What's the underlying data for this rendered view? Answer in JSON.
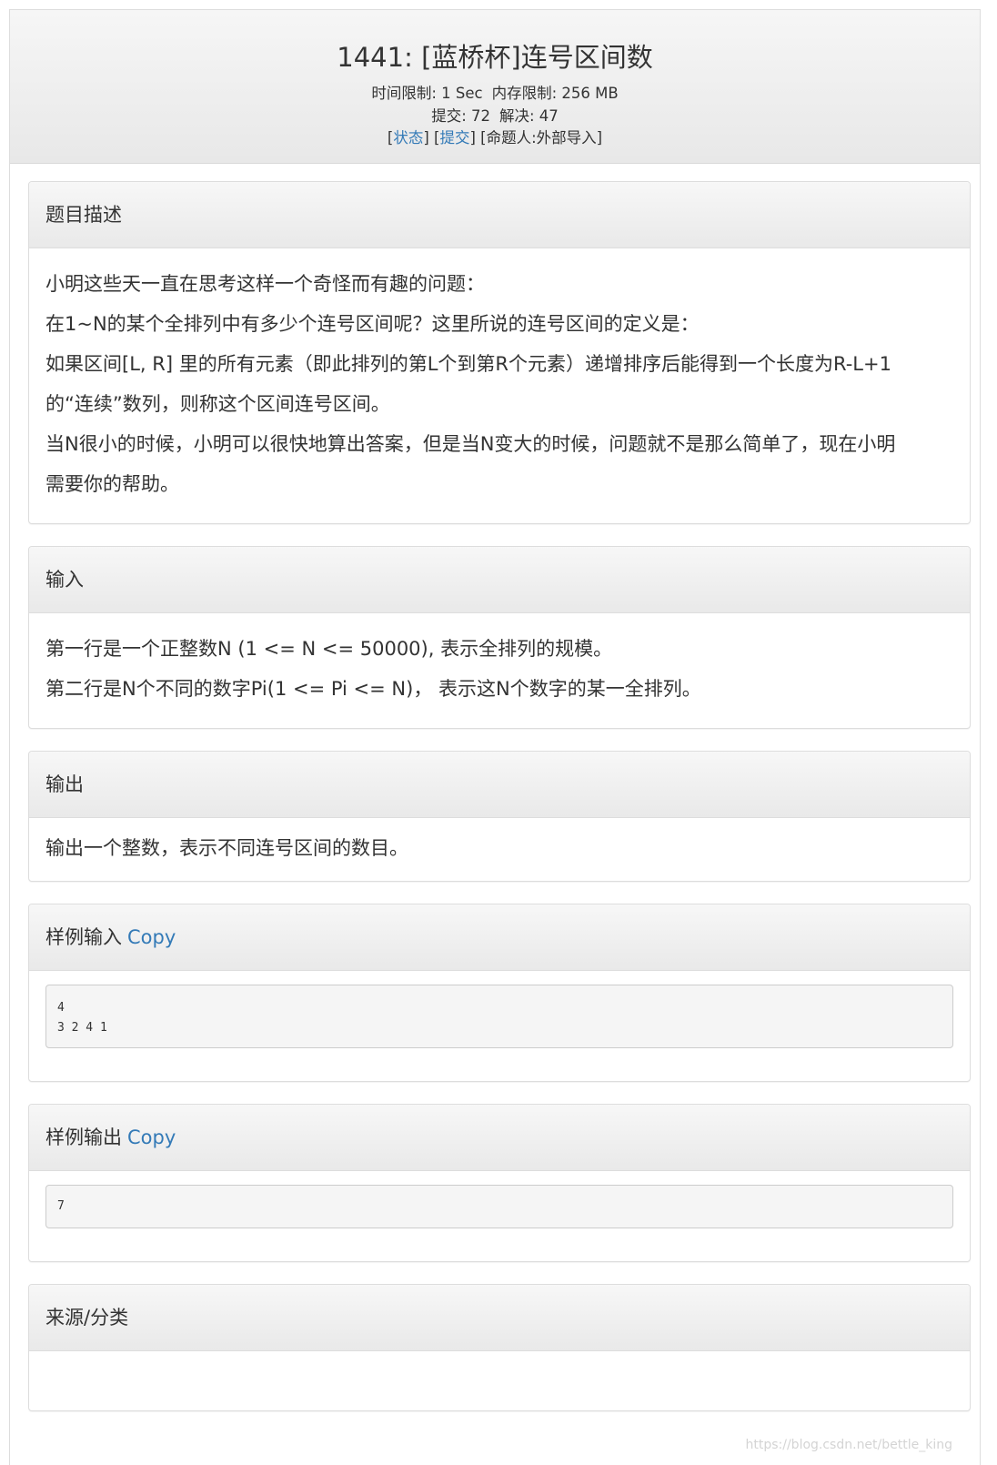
{
  "header": {
    "title": "1441: [蓝桥杯]连号区间数",
    "time_limit": "时间限制: 1 Sec",
    "memory_limit": "内存限制: 256 MB",
    "submissions": "提交: 72",
    "solved": "解决: 47",
    "status_link": "状态",
    "submit_link": "提交",
    "author": "命题人:外部导入"
  },
  "description": {
    "heading": "题目描述",
    "lines": [
      "小明这些天一直在思考这样一个奇怪而有趣的问题：",
      "在1~N的某个全排列中有多少个连号区间呢？这里所说的连号区间的定义是：",
      "如果区间[L, R] 里的所有元素（即此排列的第L个到第R个元素）递增排序后能得到一个长度为R-L+1",
      "的“连续”数列，则称这个区间连号区间。",
      "当N很小的时候，小明可以很快地算出答案，但是当N变大的时候，问题就不是那么简单了，现在小明",
      "需要你的帮助。"
    ]
  },
  "input": {
    "heading": "输入",
    "lines": [
      "第一行是一个正整数N (1 <= N <= 50000), 表示全排列的规模。",
      "第二行是N个不同的数字Pi(1 <= Pi <= N)， 表示这N个数字的某一全排列。"
    ]
  },
  "output": {
    "heading": "输出",
    "lines": [
      "输出一个整数，表示不同连号区间的数目。"
    ]
  },
  "sample_input": {
    "heading": "样例输入",
    "copy": "Copy",
    "code": "4\n3 2 4 1"
  },
  "sample_output": {
    "heading": "样例输出",
    "copy": "Copy",
    "code": "7"
  },
  "source": {
    "heading": "来源/分类"
  },
  "watermark": "https://blog.csdn.net/bettle_king"
}
